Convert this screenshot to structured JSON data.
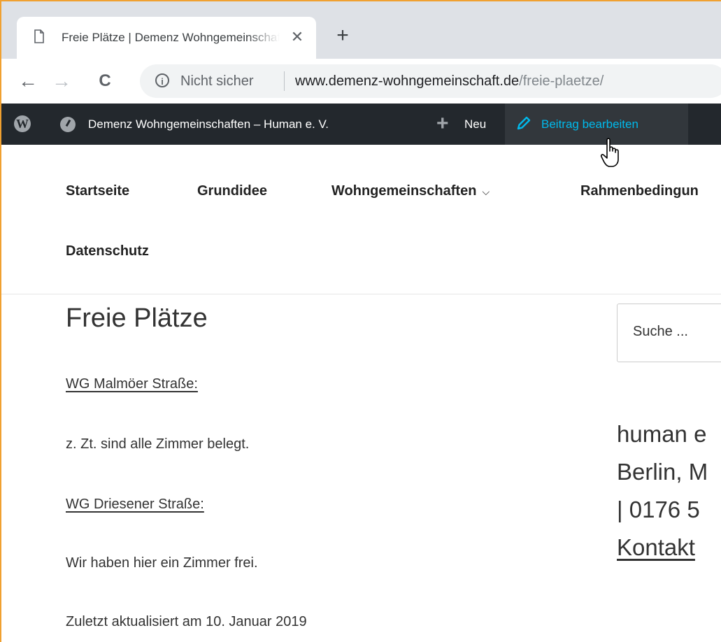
{
  "browser": {
    "tab": {
      "title": "Freie Plätze | Demenz Wohngemeinschaften – Human e. V.",
      "close_glyph": "✕"
    },
    "new_tab_glyph": "+",
    "nav": {
      "back": "←",
      "forward": "→",
      "reload": "C"
    },
    "omnibox": {
      "security_label": "Nicht sicher",
      "url_host": "www.demenz-wohngemeinschaft.de",
      "url_path": "/freie-plaetze/"
    }
  },
  "adminbar": {
    "site_name": "Demenz Wohngemeinschaften – Human e. V.",
    "new_label": "Neu",
    "edit_label": "Beitrag bearbeiten",
    "plus_glyph": "+",
    "colors": {
      "background": "#23282d",
      "edit_highlight": "#00b9eb"
    }
  },
  "site_nav": {
    "items": [
      "Startseite",
      "Grundidee",
      "Wohngemeinschaften",
      "Rahmenbedingun",
      "Datenschutz"
    ],
    "dropdown_glyph": "⌵"
  },
  "content": {
    "title": "Freie Plätze",
    "wg1_heading": "WG Malmöer Straße:",
    "wg1_text": "z. Zt. sind alle Zimmer belegt.",
    "wg2_heading": "WG Driesener Straße:",
    "wg2_text": "Wir haben hier ein Zimmer frei.",
    "updated": "Zuletzt aktualisiert am 10. Januar 2019"
  },
  "sidebar": {
    "search_placeholder": "Suche ...",
    "widget_lines": [
      "human e",
      "Berlin, M",
      "| 0176 5"
    ],
    "contact_link": "Kontakt"
  }
}
